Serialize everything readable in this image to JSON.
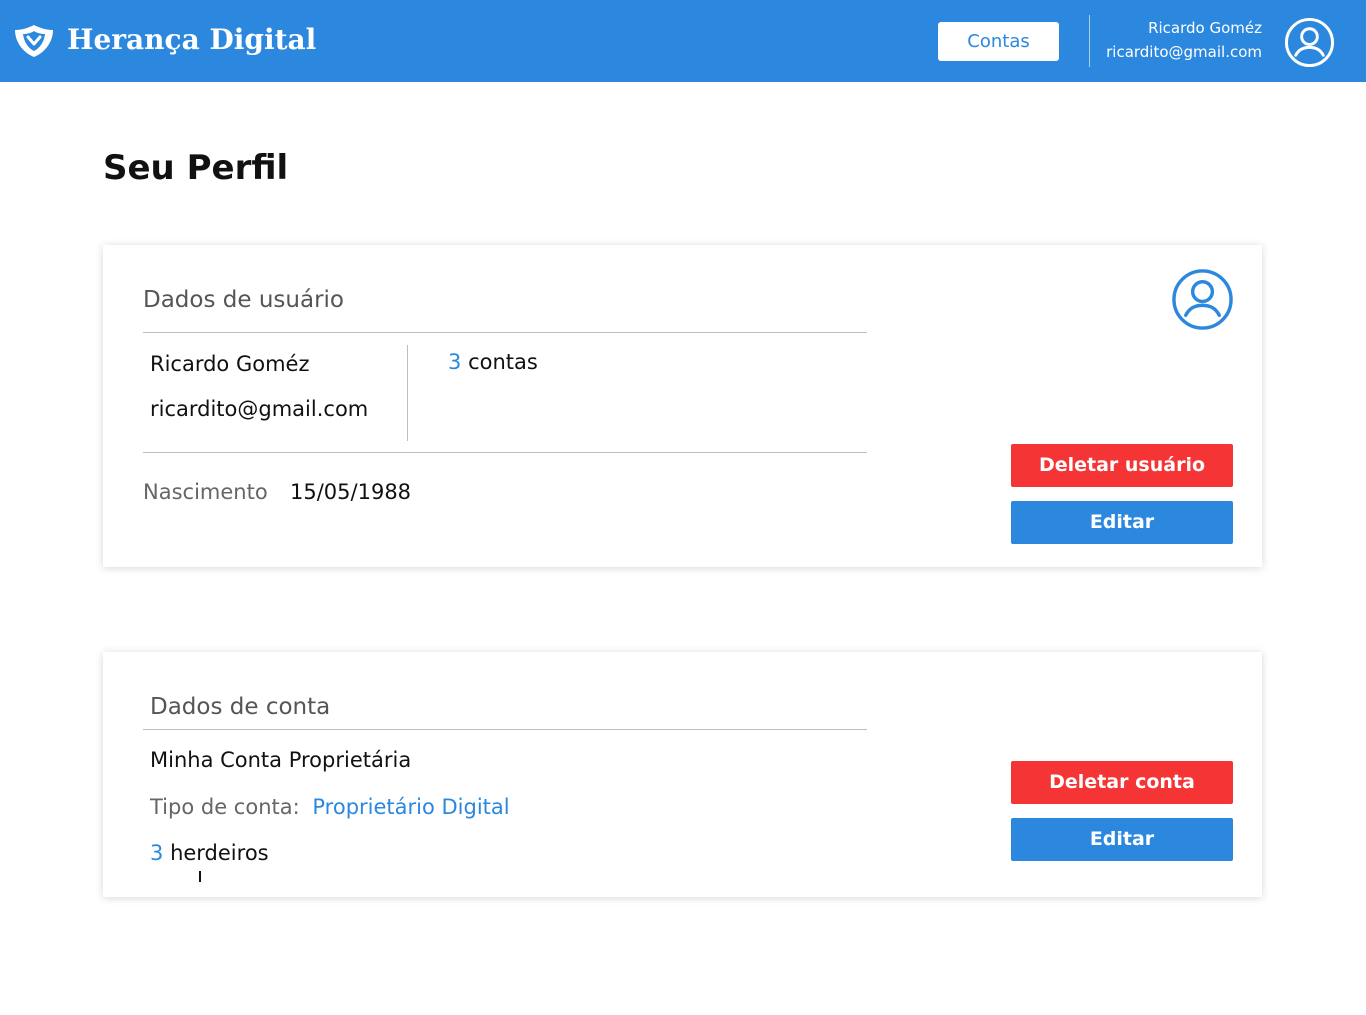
{
  "brand": {
    "name": "Herança Digital",
    "primary_color": "#2b88de",
    "danger_color": "#f53535"
  },
  "header": {
    "accounts_button": "Contas",
    "user_name": "Ricardo Goméz",
    "user_email": "ricardito@gmail.com",
    "avatar_icon": "user-circle-icon"
  },
  "page": {
    "title": "Seu Perfil"
  },
  "user_card": {
    "title": "Dados de usuário",
    "name": "Ricardo Goméz",
    "email": "ricardito@gmail.com",
    "accounts_count": "3",
    "accounts_label": "contas",
    "birth_label": "Nascimento",
    "birth_value": "15/05/1988",
    "delete_button": "Deletar usuário",
    "edit_button": "Editar",
    "avatar_icon": "user-circle-icon"
  },
  "account_card": {
    "title": "Dados de conta",
    "account_name": "Minha Conta Proprietária",
    "type_label": "Tipo de conta:",
    "type_value": "Proprietário Digital",
    "heirs_count": "3",
    "heirs_label": "herdeiros",
    "delete_button": "Deletar conta",
    "edit_button": "Editar"
  }
}
